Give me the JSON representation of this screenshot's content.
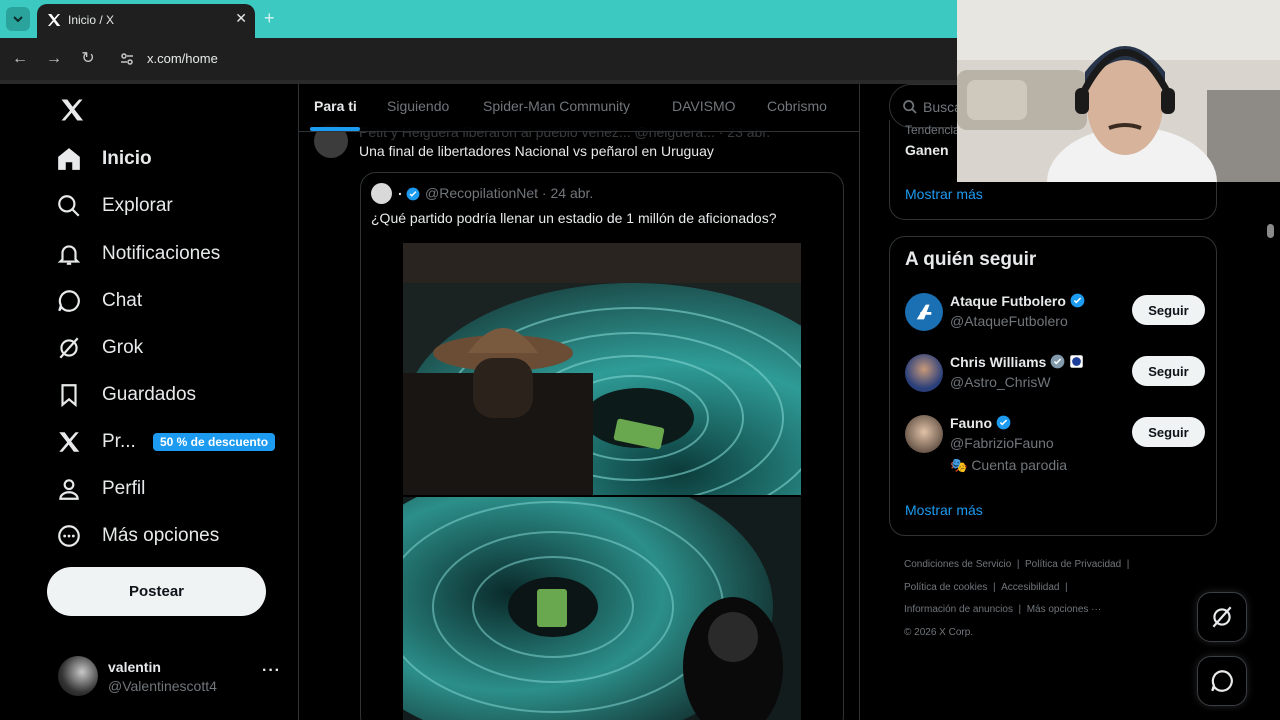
{
  "browser": {
    "tab_title": "Inicio / X",
    "tab_close": "✕",
    "new_tab": "+",
    "url": "x.com/home"
  },
  "nav": {
    "items": [
      {
        "label": "Inicio"
      },
      {
        "label": "Explorar"
      },
      {
        "label": "Notificaciones"
      },
      {
        "label": "Chat"
      },
      {
        "label": "Grok"
      },
      {
        "label": "Guardados"
      },
      {
        "label": "Pr..."
      },
      {
        "label": "Perfil"
      },
      {
        "label": "Más opciones"
      }
    ],
    "premium_badge": "50 % de descuento",
    "post_button": "Postear",
    "account": {
      "name": "valentin",
      "handle": "@Valentinescott4",
      "more": "···"
    }
  },
  "feed": {
    "tabs": [
      "Para ti",
      "Siguiendo",
      "Spider-Man Community",
      "DAVISMO",
      "Cobrismo"
    ],
    "post": {
      "hidden_header": "Petit y Heiguera liberaron al pueblo venez...  @heiguera... · 23 abr.",
      "text": "Una final de libertadores Nacional vs peñarol en Uruguay",
      "quote": {
        "name": ".",
        "handle_time": "@RecopilationNet · 24 abr.",
        "text": "¿Qué partido podría llenar un estadio de 1 millón de aficionados?"
      }
    }
  },
  "right": {
    "search_placeholder": "Busca",
    "trend_label": "Tendencia",
    "trend_name": "Ganen",
    "show_more": "Mostrar más",
    "follow_title": "A quién seguir",
    "follow": [
      {
        "name": "Ataque Futbolero",
        "handle": "@AtaqueFutbolero",
        "button": "Seguir",
        "extra": ""
      },
      {
        "name": "Chris Williams",
        "handle": "@Astro_ChrisW",
        "button": "Seguir",
        "extra": ""
      },
      {
        "name": "Fauno",
        "handle": "@FabrizioFauno",
        "button": "Seguir",
        "extra": "🎭 Cuenta parodia"
      }
    ],
    "follow_show_more": "Mostrar más",
    "footer": {
      "terms": "Condiciones de Servicio",
      "privacy": "Política de Privacidad",
      "cookies": "Política de cookies",
      "accessibility": "Accesibilidad",
      "ads": "Información de anuncios",
      "more": "Más opciones ···",
      "copyright": "© 2026 X Corp."
    }
  },
  "colors": {
    "accent": "#1d9bf0",
    "tabstrip": "#3bc9c2"
  }
}
